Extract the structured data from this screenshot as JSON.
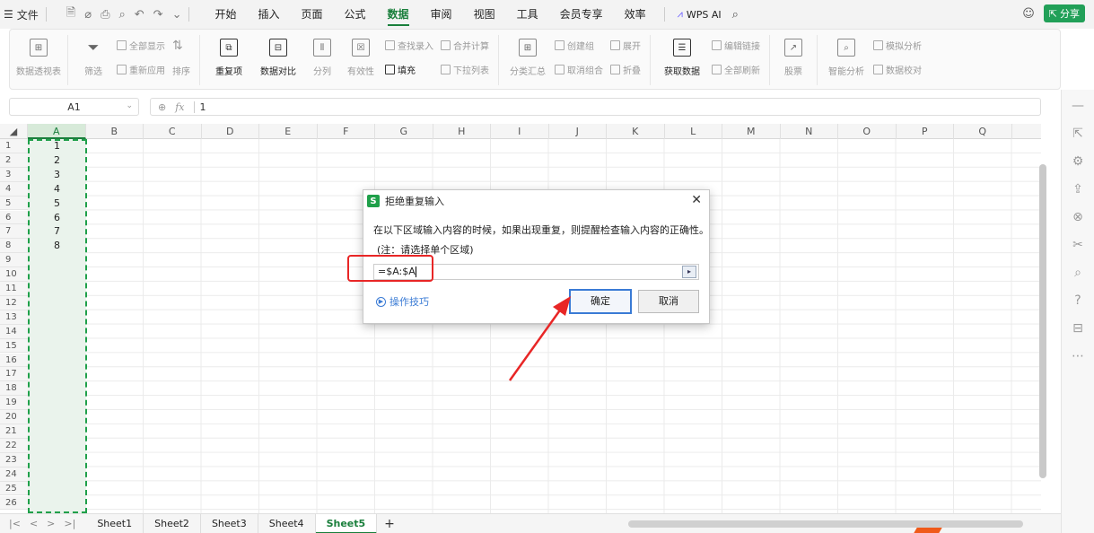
{
  "menubar": {
    "file_label": "文件",
    "tabs": [
      {
        "label": "开始",
        "active": false
      },
      {
        "label": "插入",
        "active": false
      },
      {
        "label": "页面",
        "active": false
      },
      {
        "label": "公式",
        "active": false
      },
      {
        "label": "数据",
        "active": true
      },
      {
        "label": "审阅",
        "active": false
      },
      {
        "label": "视图",
        "active": false
      },
      {
        "label": "工具",
        "active": false
      },
      {
        "label": "会员专享",
        "active": false
      },
      {
        "label": "效率",
        "active": false
      }
    ],
    "wps_ai_label": "WPS AI",
    "share_label": "分享"
  },
  "ribbon": {
    "pivot_table": "数据透视表",
    "filter": "筛选",
    "show_all": "全部显示",
    "reapply": "重新应用",
    "sort": "排序",
    "duplicates": "重复项",
    "compare": "数据对比",
    "split": "分列",
    "validity": "有效性",
    "find_entry": "查找录入",
    "fill": "填充",
    "merge_calc": "合并计算",
    "dropdown_list": "下拉列表",
    "subtotal": "分类汇总",
    "create_group": "创建组",
    "ungroup": "取消组合",
    "expand": "展开",
    "collapse": "折叠",
    "get_data": "获取数据",
    "edit_links": "编辑链接",
    "refresh_all": "全部刷新",
    "stocks": "股票",
    "smart_analysis": "智能分析",
    "simulation": "模拟分析",
    "data_check": "数据校对"
  },
  "formula_bar": {
    "cell_ref": "A1",
    "value": "1"
  },
  "grid": {
    "columns": [
      "A",
      "B",
      "C",
      "D",
      "E",
      "F",
      "G",
      "H",
      "I",
      "J",
      "K",
      "L",
      "M",
      "N",
      "O",
      "P",
      "Q"
    ],
    "rows": [
      "1",
      "2",
      "3",
      "4",
      "5",
      "6",
      "7",
      "8",
      "9",
      "10",
      "11",
      "12",
      "13",
      "14",
      "15",
      "16",
      "17",
      "18",
      "19",
      "20",
      "21",
      "22",
      "23",
      "24",
      "25",
      "26"
    ],
    "column_a_values": [
      "1",
      "2",
      "3",
      "4",
      "5",
      "6",
      "7",
      "8"
    ]
  },
  "sheets": [
    {
      "label": "Sheet1",
      "active": false
    },
    {
      "label": "Sheet2",
      "active": false
    },
    {
      "label": "Sheet3",
      "active": false
    },
    {
      "label": "Sheet4",
      "active": false
    },
    {
      "label": "Sheet5",
      "active": true
    }
  ],
  "dialog": {
    "title": "拒绝重复输入",
    "message": "在以下区域输入内容的时候，如果出现重复，则提醒检查输入内容的正确性。",
    "note": "(注：请选择单个区域)",
    "range_value": "=$A:$A",
    "tips_label": "操作技巧",
    "ok_label": "确定",
    "cancel_label": "取消"
  },
  "colors": {
    "accent_green": "#1a7f3c",
    "annotation_red": "#e82626",
    "link_blue": "#3a7bd5"
  }
}
